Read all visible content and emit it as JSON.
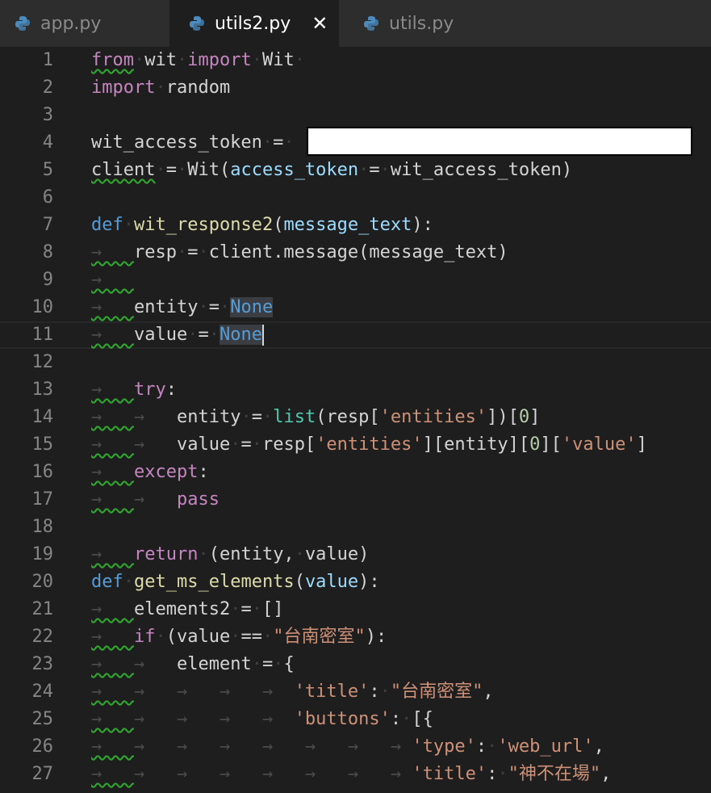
{
  "tabs": [
    {
      "label": "app.py",
      "active": false
    },
    {
      "label": "utils2.py",
      "active": true,
      "close": "✕"
    },
    {
      "label": "utils.py",
      "active": false
    }
  ],
  "colors": {
    "background": "#1e1e1e",
    "tabbar": "#2d2d2d",
    "keyword": "#c586c0",
    "keyword_blue": "#569cd6",
    "function": "#dcdcaa",
    "string": "#ce9178",
    "squiggle": "#2fa52f"
  },
  "lines": [
    {
      "n": "1",
      "html": "<span class='kw squig'>from</span><span class='ws'>·</span>wit<span class='ws'>·</span><span class='kw'>import</span><span class='ws'>·</span>Wit<span class='ws'>·</span>"
    },
    {
      "n": "2",
      "html": "<span class='kw'>import</span><span class='ws'>·</span>random"
    },
    {
      "n": "3",
      "html": ""
    },
    {
      "n": "4",
      "html": "wit_access_token<span class='ws'>·</span>=<span class='ws'>·</span>"
    },
    {
      "n": "5",
      "html": "<span class='squig'>client</span><span class='ws'>·</span>=<span class='ws'>·</span>Wit(<span class='param'>access_token</span><span class='ws'>·</span>=<span class='ws'>·</span>wit_access_token)"
    },
    {
      "n": "6",
      "html": ""
    },
    {
      "n": "7",
      "html": "<span class='kw2'>def</span><span class='ws'>·</span><span class='fn'>wit_response2</span>(<span class='param'>message_text</span>):"
    },
    {
      "n": "8",
      "html": "<span class='arrow squig'>→   </span>resp<span class='ws'>·</span>=<span class='ws'>·</span>client.message(message_text)"
    },
    {
      "n": "9",
      "html": "<span class='arrow squig'>→   </span>"
    },
    {
      "n": "10",
      "html": "<span class='arrow squig'>→   </span>entity<span class='ws'>·</span>=<span class='ws'>·</span><span class='kw2 hl'>None</span>"
    },
    {
      "n": "11",
      "html": "<span class='arrow squig'>→   </span>value<span class='ws'>·</span>=<span class='ws'>·</span><span class='kw2 hl'>None</span><span class='cursor'></span>",
      "current": true
    },
    {
      "n": "12",
      "html": ""
    },
    {
      "n": "13",
      "html": "<span class='arrow squig'>→   </span><span class='kw'>try</span>:"
    },
    {
      "n": "14",
      "html": "<span class='arrow squig'>→   </span><span class='arrow'>→   </span>entity<span class='ws'>·</span>=<span class='ws'>·</span><span class='builtin'>list</span>(resp[<span class='str'>'entities'</span>])[<span class='num'>0</span>]"
    },
    {
      "n": "15",
      "html": "<span class='arrow squig'>→   </span><span class='arrow'>→   </span>value<span class='ws'>·</span>=<span class='ws'>·</span>resp[<span class='str'>'entities'</span>][entity][<span class='num'>0</span>][<span class='str'>'value'</span>]"
    },
    {
      "n": "16",
      "html": "<span class='arrow squig'>→   </span><span class='kw'>except</span>:"
    },
    {
      "n": "17",
      "html": "<span class='arrow squig'>→   </span><span class='arrow'>→   </span><span class='kw'>pass</span>"
    },
    {
      "n": "18",
      "html": ""
    },
    {
      "n": "19",
      "html": "<span class='arrow squig'>→   </span><span class='kw'>return</span><span class='ws'>·</span>(entity,<span class='ws'>·</span>value)"
    },
    {
      "n": "20",
      "html": "<span class='kw2'>def</span><span class='ws'>·</span><span class='fn'>get_ms_elements</span>(<span class='param'>value</span>):"
    },
    {
      "n": "21",
      "html": "<span class='arrow squig'>→   </span>elements2<span class='ws'>·</span>=<span class='ws'>·</span>[]"
    },
    {
      "n": "22",
      "html": "<span class='arrow squig'>→   </span><span class='kw'>if</span><span class='ws'>·</span>(value<span class='ws'>·</span>==<span class='ws'>·</span><span class='str'>\"台南密室\"</span>):"
    },
    {
      "n": "23",
      "html": "<span class='arrow squig'>→   </span><span class='arrow'>→   </span>element<span class='ws'>·</span>=<span class='ws'>·</span>{"
    },
    {
      "n": "24",
      "html": "<span class='arrow squig'>→   </span><span class='arrow'>→   </span><span class='arrow'>→   </span><span class='arrow'>→   </span><span class='arrow'>→  </span><span class='str'>'title'</span>:<span class='ws'>·</span><span class='str'>\"台南密室\"</span>,"
    },
    {
      "n": "25",
      "html": "<span class='arrow squig'>→   </span><span class='arrow'>→   </span><span class='arrow'>→   </span><span class='arrow'>→   </span><span class='arrow'>→  </span><span class='str'>'buttons'</span>:<span class='ws'>·</span>[{"
    },
    {
      "n": "26",
      "html": "<span class='arrow squig'>→   </span><span class='arrow'>→   </span><span class='arrow'>→   </span><span class='arrow'>→   </span><span class='arrow'>→   </span><span class='arrow'>→   </span><span class='arrow'>→   </span><span class='arrow'>→ </span><span class='str'>'type'</span>:<span class='ws'>·</span><span class='str'>'web_url'</span>,"
    },
    {
      "n": "27",
      "html": "<span class='arrow squig'>→   </span><span class='arrow'>→   </span><span class='arrow'>→   </span><span class='arrow'>→   </span><span class='arrow'>→   </span><span class='arrow'>→   </span><span class='arrow'>→   </span><span class='arrow'>→ </span><span class='str'>'title'</span>:<span class='ws'>·</span><span class='str'>\"神不在場\"</span>,"
    }
  ]
}
